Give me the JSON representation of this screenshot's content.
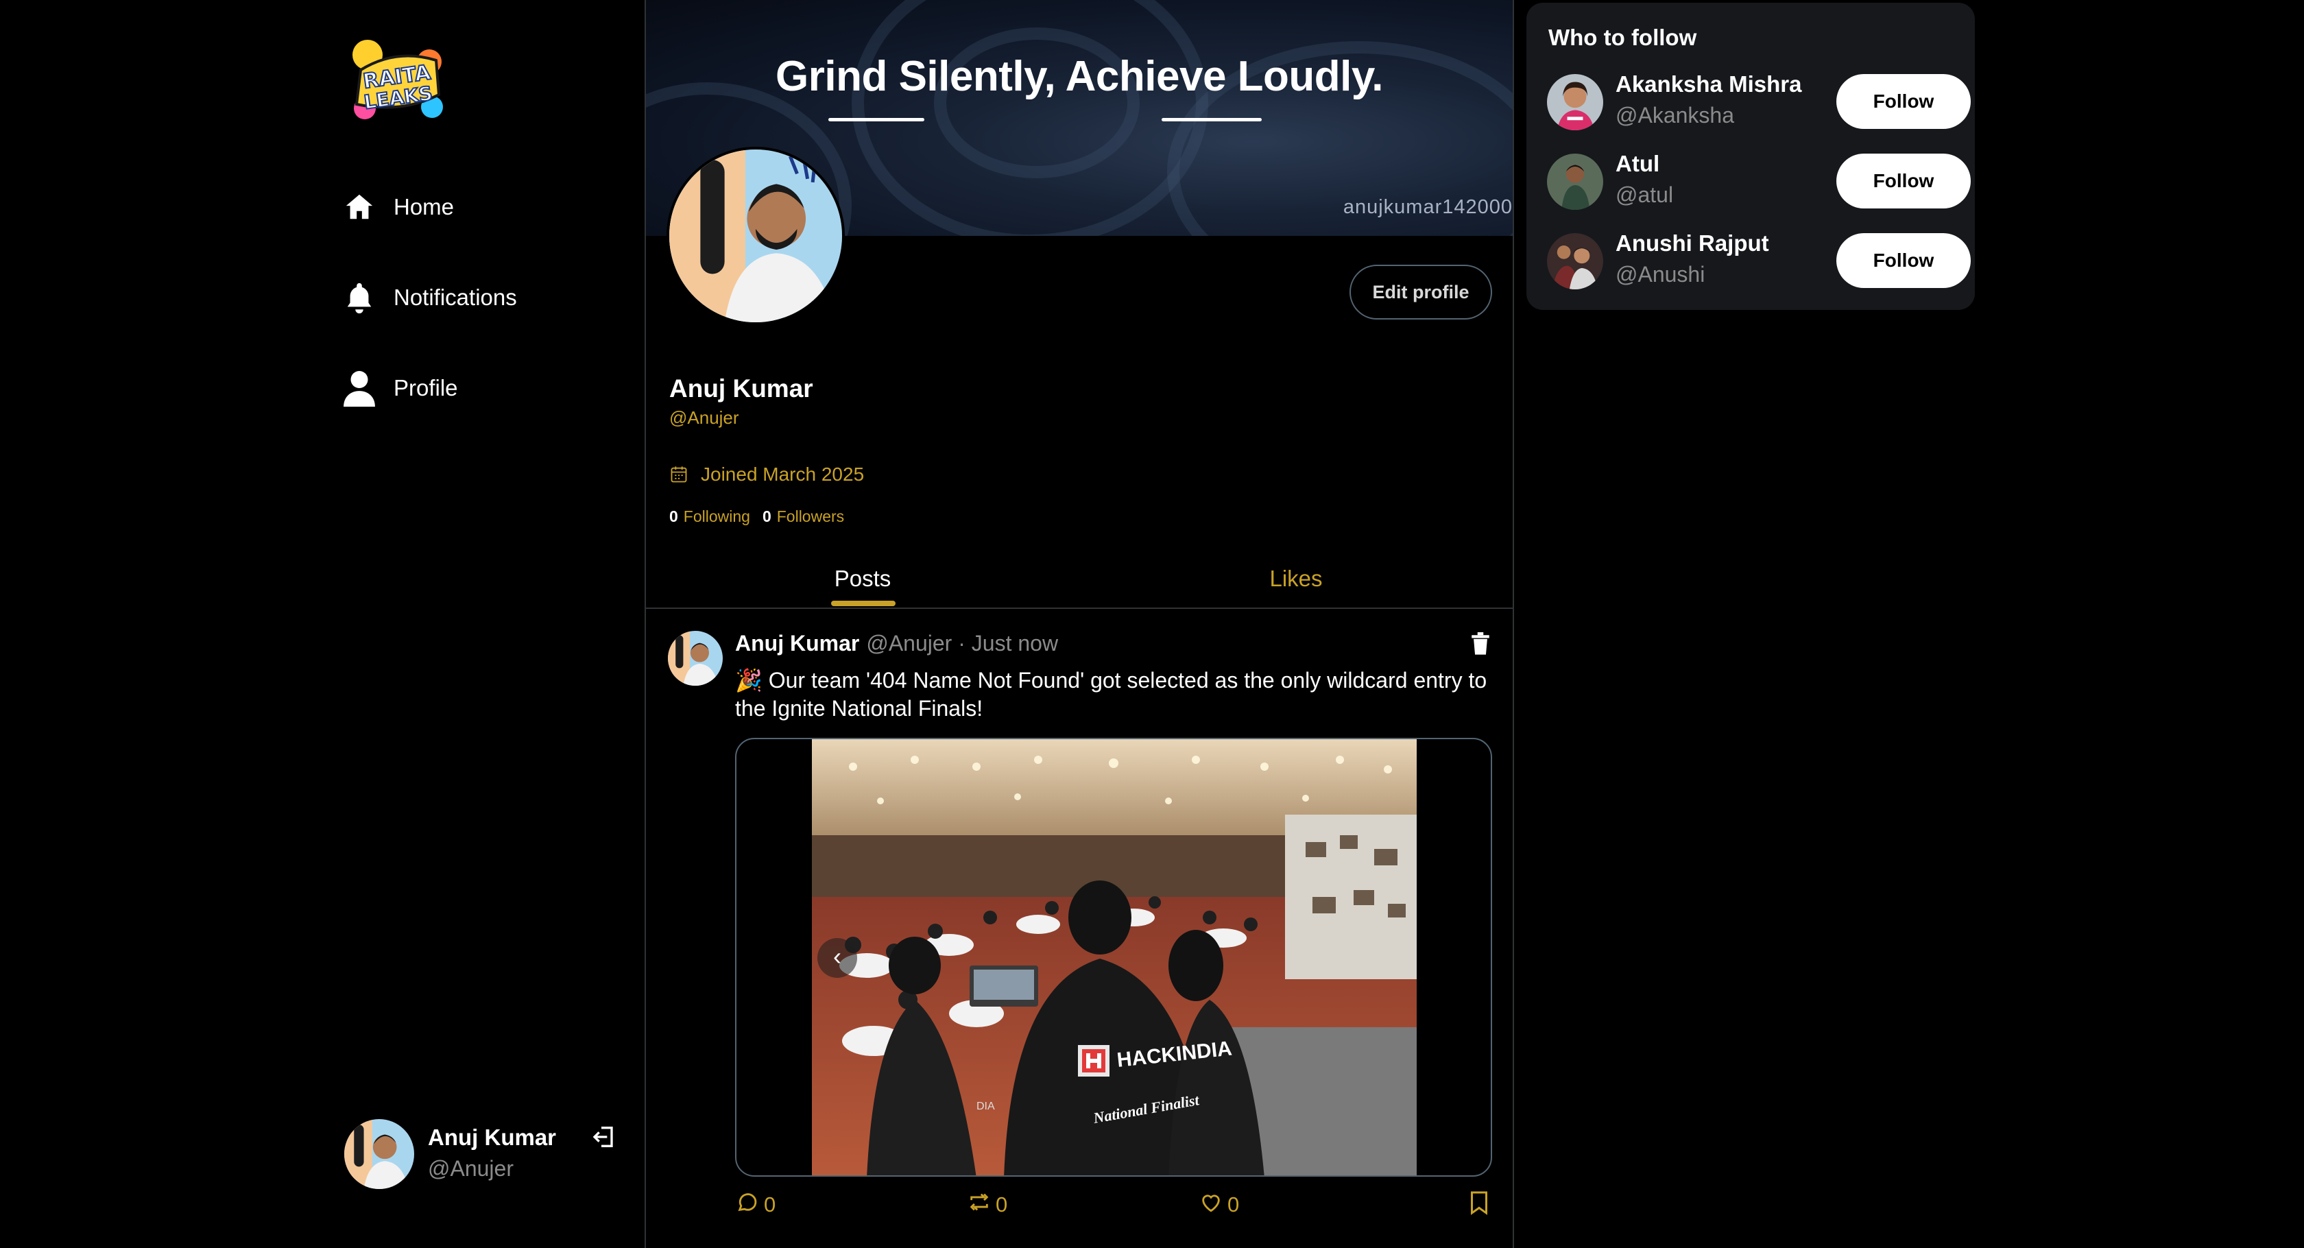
{
  "app": {
    "logo_text_line1": "RAITA",
    "logo_text_line2": "LEAKS"
  },
  "nav": {
    "items": [
      {
        "label": "Home",
        "icon": "home-icon"
      },
      {
        "label": "Notifications",
        "icon": "bell-icon"
      },
      {
        "label": "Profile",
        "icon": "user-icon"
      }
    ]
  },
  "current_user": {
    "name": "Anuj Kumar",
    "handle": "@Anujer"
  },
  "profile": {
    "banner_title": "Grind Silently, Achieve Loudly.",
    "banner_tag": "anujkumar142000",
    "edit_label": "Edit profile",
    "name": "Anuj Kumar",
    "handle": "@Anujer",
    "joined": "Joined March 2025",
    "following_count": "0",
    "following_label": "Following",
    "followers_count": "0",
    "followers_label": "Followers"
  },
  "tabs": [
    {
      "label": "Posts",
      "active": true
    },
    {
      "label": "Likes",
      "active": false
    }
  ],
  "post": {
    "author": "Anuj Kumar",
    "handle": "@Anujer · Just now",
    "emoji": "🎉",
    "text": "Our team '404 Name Not Found' got selected as the only wildcard entry to the Ignite National Finals!",
    "photo_shirt_brand": "HACKINDIA",
    "photo_shirt_caption": "National Finalist",
    "photo_sleeve_text": "DIA",
    "prev_arrow": "‹",
    "comments": "0",
    "reposts": "0",
    "likes": "0"
  },
  "who_to_follow": {
    "title": "Who to follow",
    "follow_label": "Follow",
    "users": [
      {
        "name": "Akanksha Mishra",
        "handle": "@Akanksha"
      },
      {
        "name": "Atul",
        "handle": "@atul"
      },
      {
        "name": "Anushi Rajput",
        "handle": "@Anushi"
      }
    ]
  },
  "colors": {
    "accent": "#c9a227",
    "background": "#000000",
    "panel": "#16181c",
    "border": "#2f3336",
    "muted": "#8b8b8b"
  }
}
